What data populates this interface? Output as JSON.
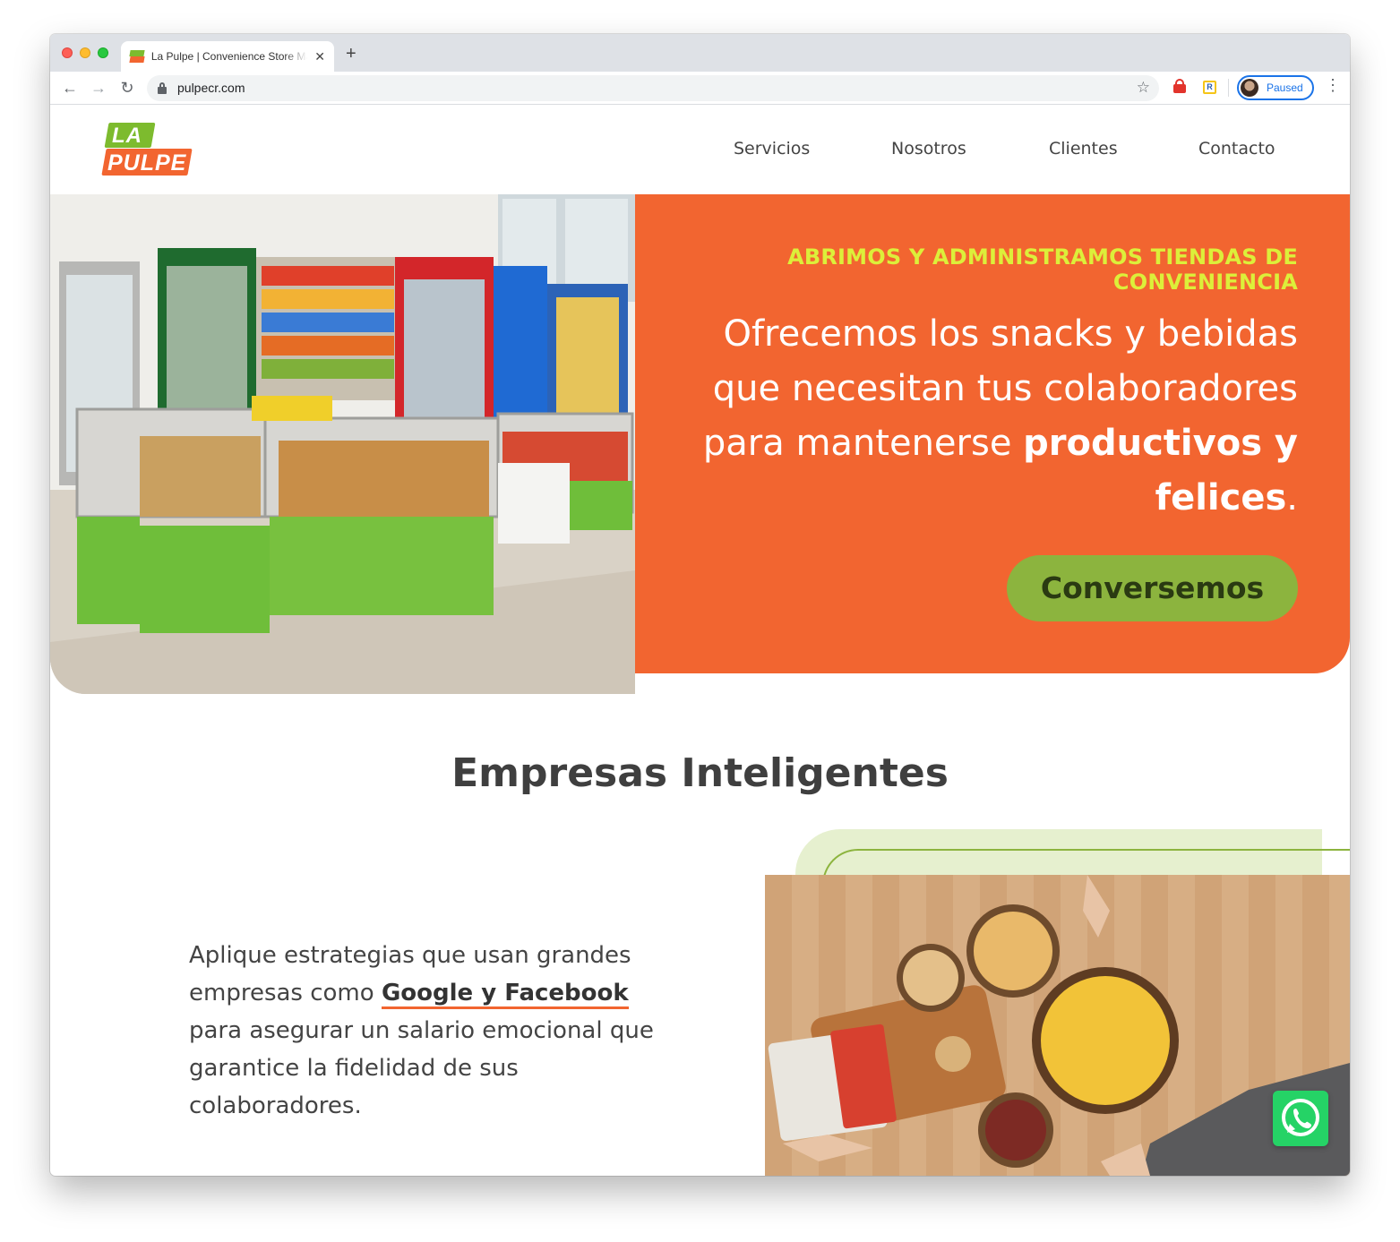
{
  "browser": {
    "tab_title": "La Pulpe | Convenience Store Ma",
    "new_tab_symbol": "+",
    "url": "pulpecr.com",
    "profile_status": "Paused"
  },
  "site": {
    "logo_top": "LA",
    "logo_bottom": "PULPE",
    "nav": [
      "Servicios",
      "Nosotros",
      "Clientes",
      "Contacto"
    ]
  },
  "hero": {
    "kicker": "ABRIMOS Y ADMINISTRAMOS TIENDAS DE CONVENIENCIA",
    "headline_regular": "Ofrecemos los snacks y bebidas que necesitan tus colaboradores para mantenerse ",
    "headline_bold": "productivos y felices",
    "headline_end": ".",
    "cta_label": "Conversemos"
  },
  "section": {
    "title": "Empresas Inteligentes",
    "text_1": "Aplique estrategias que usan grandes empresas como ",
    "text_bold": "Google y Facebook",
    "text_2": " para asegurar un salario emocional que garantice la fidelidad de sus colaboradores."
  },
  "colors": {
    "brand_orange": "#f26530",
    "brand_green": "#8cb43e",
    "kicker_yellow": "#dcef3a",
    "whatsapp_green": "#25d366"
  }
}
